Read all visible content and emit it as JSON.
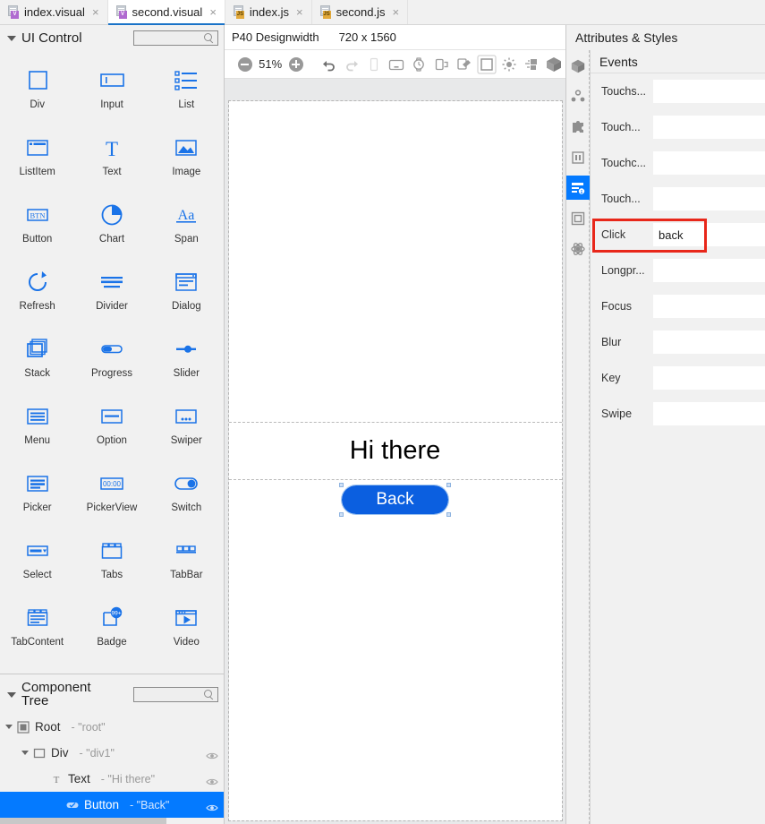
{
  "tabs": [
    {
      "label": "index.visual",
      "type": "visual",
      "badge": "V",
      "active": false,
      "close": "×"
    },
    {
      "label": "second.visual",
      "type": "visual",
      "badge": "V",
      "active": true,
      "close": "×"
    },
    {
      "label": "index.js",
      "type": "js",
      "badge": "JS",
      "active": false,
      "close": "×"
    },
    {
      "label": "second.js",
      "type": "js",
      "badge": "JS",
      "active": false,
      "close": "×"
    }
  ],
  "left_panel": {
    "title": "UI Control",
    "search_placeholder": "",
    "search_value": "",
    "search_icon": "search-icon",
    "collapse_icon": "chevron-down-icon",
    "components": [
      {
        "label": "Div",
        "icon": "div-icon"
      },
      {
        "label": "Input",
        "icon": "input-icon"
      },
      {
        "label": "List",
        "icon": "list-icon"
      },
      {
        "label": "ListItem",
        "icon": "listitem-icon"
      },
      {
        "label": "Text",
        "icon": "text-icon"
      },
      {
        "label": "Image",
        "icon": "image-icon"
      },
      {
        "label": "Button",
        "icon": "button-icon"
      },
      {
        "label": "Chart",
        "icon": "chart-icon"
      },
      {
        "label": "Span",
        "icon": "span-icon"
      },
      {
        "label": "Refresh",
        "icon": "refresh-icon"
      },
      {
        "label": "Divider",
        "icon": "divider-icon"
      },
      {
        "label": "Dialog",
        "icon": "dialog-icon"
      },
      {
        "label": "Stack",
        "icon": "stack-icon"
      },
      {
        "label": "Progress",
        "icon": "progress-icon"
      },
      {
        "label": "Slider",
        "icon": "slider-icon"
      },
      {
        "label": "Menu",
        "icon": "menu-icon"
      },
      {
        "label": "Option",
        "icon": "option-icon"
      },
      {
        "label": "Swiper",
        "icon": "swiper-icon"
      },
      {
        "label": "Picker",
        "icon": "picker-icon"
      },
      {
        "label": "PickerView",
        "icon": "pickerview-icon",
        "glyph_text": "00:00"
      },
      {
        "label": "Switch",
        "icon": "switch-icon"
      },
      {
        "label": "Select",
        "icon": "select-icon"
      },
      {
        "label": "Tabs",
        "icon": "tabs-icon"
      },
      {
        "label": "TabBar",
        "icon": "tabbar-icon"
      },
      {
        "label": "TabContent",
        "icon": "tabcontent-icon"
      },
      {
        "label": "Badge",
        "icon": "badge-icon",
        "glyph_text": "99+"
      },
      {
        "label": "Video",
        "icon": "video-icon"
      }
    ]
  },
  "component_tree": {
    "title": "Component Tree",
    "search_value": "",
    "search_icon": "search-icon",
    "collapse_icon": "chevron-down-icon",
    "rows": [
      {
        "name": "Root",
        "value": "- \"root\"",
        "indent": 0,
        "icon": "root-icon",
        "selected": false,
        "has_caret": true,
        "has_eye": false
      },
      {
        "name": "Div",
        "value": "- \"div1\"",
        "indent": 1,
        "icon": "div-icon",
        "selected": false,
        "has_caret": true,
        "has_eye": true
      },
      {
        "name": "Text",
        "value": "- \"Hi there\"",
        "indent": 2,
        "icon": "text-icon",
        "selected": false,
        "has_caret": false,
        "has_eye": true
      },
      {
        "name": "Button",
        "value": "- \"Back\"",
        "indent": 3,
        "icon": "button-icon",
        "selected": true,
        "has_caret": false,
        "has_eye": true
      }
    ]
  },
  "center": {
    "device_label": "P40 Designwidth",
    "resolution": "720 x 1560",
    "zoom": "51%",
    "zoom_out_icon": "minus-circle-icon",
    "zoom_in_icon": "plus-circle-icon",
    "toolbar_icons": [
      {
        "name": "undo-icon",
        "enabled": true
      },
      {
        "name": "redo-icon",
        "enabled": false
      },
      {
        "name": "phone-icon",
        "enabled": false
      },
      {
        "name": "tv-icon",
        "enabled": true
      },
      {
        "name": "watch-icon",
        "enabled": true
      },
      {
        "name": "foldable-icon",
        "enabled": true
      },
      {
        "name": "multi-device-icon",
        "enabled": true
      },
      {
        "name": "frame-icon",
        "enabled": true,
        "selected": true
      },
      {
        "name": "brightness-icon",
        "enabled": true
      },
      {
        "name": "component-add-icon",
        "enabled": true
      },
      {
        "name": "cube-icon",
        "enabled": true
      }
    ],
    "preview": {
      "text": "Hi there",
      "button_label": "Back",
      "button_color": "#0b5fe0"
    }
  },
  "right_panel": {
    "title": "Attributes & Styles",
    "section_title": "Events",
    "strip_icons": [
      {
        "name": "cube-icon",
        "active": false
      },
      {
        "name": "group-icon",
        "active": false
      },
      {
        "name": "puzzle-icon",
        "active": false
      },
      {
        "name": "columns-icon",
        "active": false
      },
      {
        "name": "events-icon",
        "active": true
      },
      {
        "name": "border-icon",
        "active": false
      },
      {
        "name": "atom-icon",
        "active": false
      }
    ],
    "events": [
      {
        "label": "Touchs...",
        "value": "",
        "highlighted": false
      },
      {
        "label": "Touch...",
        "value": "",
        "highlighted": false
      },
      {
        "label": "Touchc...",
        "value": "",
        "highlighted": false
      },
      {
        "label": "Touch...",
        "value": "",
        "highlighted": false
      },
      {
        "label": "Click",
        "value": "back",
        "highlighted": true
      },
      {
        "label": "Longpr...",
        "value": "",
        "highlighted": false
      },
      {
        "label": "Focus",
        "value": "",
        "highlighted": false
      },
      {
        "label": "Blur",
        "value": "",
        "highlighted": false
      },
      {
        "label": "Key",
        "value": "",
        "highlighted": false
      },
      {
        "label": "Swipe",
        "value": "",
        "highlighted": false
      }
    ],
    "highlight_color": "#e8271a"
  }
}
